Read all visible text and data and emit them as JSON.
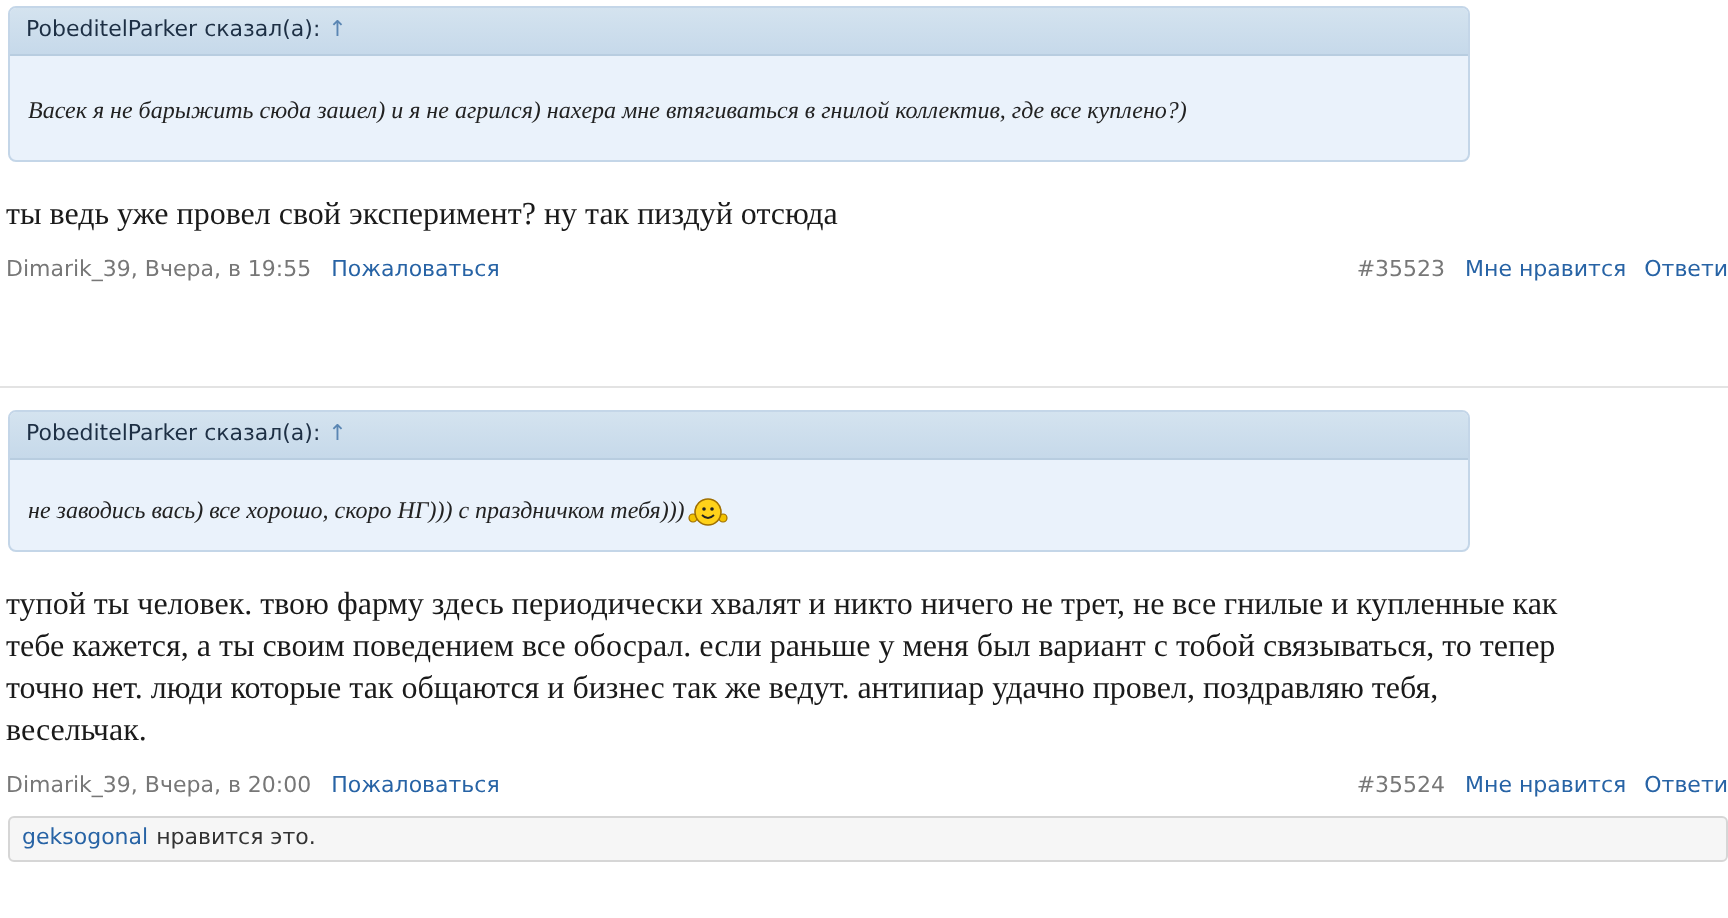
{
  "posts": [
    {
      "quote": {
        "author": "PobeditelParker сказал(а):",
        "arrow": "↑",
        "text": "Васек я не барыжить сюда зашел) и я не агрился) нахера мне втягиваться в гнилой коллектив, где все куплено?)",
        "smiley": false
      },
      "lines": [
        "ты ведь уже провел свой эксперимент? ну так пиздуй отсюда"
      ],
      "meta": {
        "author": "Dimarik_39",
        "date": ", Вчера, в 19:55",
        "report": "Пожаловаться",
        "number": "#35523",
        "like": "Мне нравится",
        "reply": "Ответи"
      }
    },
    {
      "quote": {
        "author": "PobeditelParker сказал(а):",
        "arrow": "↑",
        "text": "не заводись вась) все хорошо, скоро НГ))) с праздничком тебя)))",
        "smiley": true
      },
      "lines": [
        "тупой ты человек. твою фарму здесь периодически хвалят и никто ничего не трет, не все гнилые и купленные как",
        "тебе кажется, а ты своим поведением все обосрал. если раньше у меня был вариант с тобой связываться, то тепер",
        "точно нет. люди которые так общаются и бизнес так же ведут. антипиар удачно провел, поздравляю тебя,",
        "весельчак."
      ],
      "meta": {
        "author": "Dimarik_39",
        "date": ", Вчера, в 20:00",
        "report": "Пожаловаться",
        "number": "#35524",
        "like": "Мне нравится",
        "reply": "Ответи"
      },
      "likes": {
        "user": "geksogonal",
        "text": "нравится это."
      }
    }
  ]
}
